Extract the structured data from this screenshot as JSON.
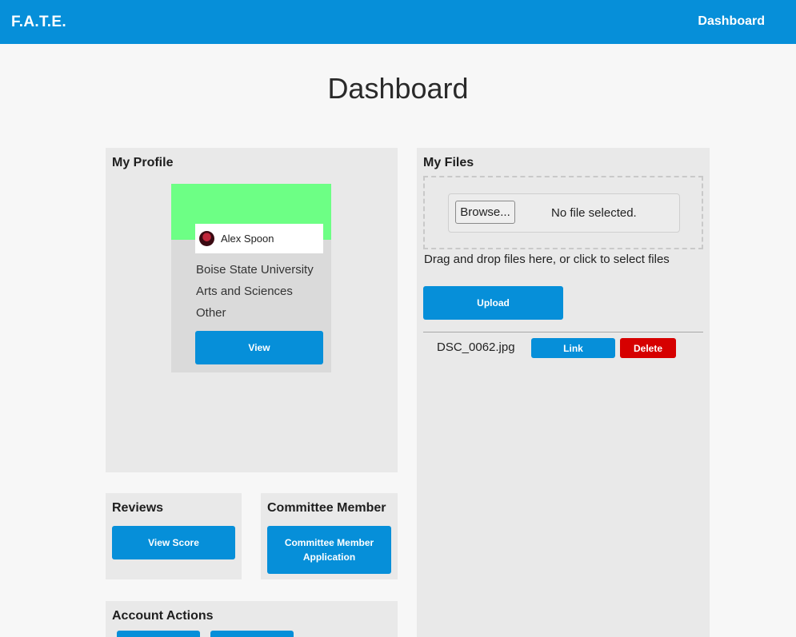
{
  "navbar": {
    "brand": "F.A.T.E.",
    "link": "Dashboard"
  },
  "page": {
    "title": "Dashboard"
  },
  "profile": {
    "title": "My Profile",
    "name": "Alex Spoon",
    "university": "Boise State University",
    "college": "Arts and Sciences",
    "other": "Other",
    "view_label": "View",
    "banner_color": "#6dff85"
  },
  "files": {
    "title": "My Files",
    "browse_label": "Browse...",
    "no_file_text": "No file selected.",
    "drop_hint": "Drag and drop files here, or click to select files",
    "upload_label": "Upload",
    "items": [
      {
        "name": "DSC_0062.jpg",
        "link_label": "Link",
        "delete_label": "Delete"
      }
    ]
  },
  "reviews": {
    "title": "Reviews",
    "button_label": "View Score"
  },
  "committee": {
    "title": "Committee Member",
    "button_label": "Committee Member Application"
  },
  "account": {
    "title": "Account Actions"
  },
  "colors": {
    "primary": "#068fd9",
    "danger": "#d60000",
    "panel": "#e9e9e9",
    "background": "#f7f7f7"
  }
}
